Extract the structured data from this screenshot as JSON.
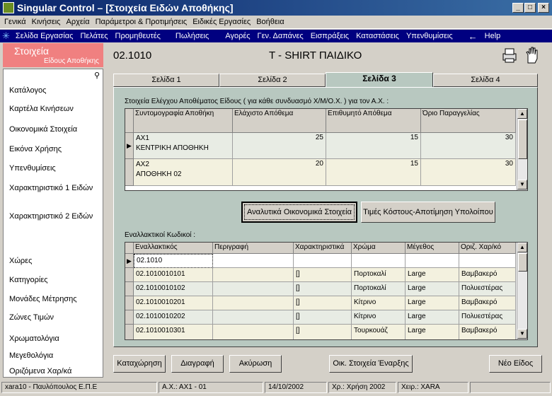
{
  "title": "Singular Control – [Στοιχεία Ειδών Αποθήκης]",
  "menu": [
    "Γενικά",
    "Κινήσεις",
    "Αρχεία",
    "Παράμετροι & Προτιμήσεις",
    "Ειδικές Εργασίες",
    "Βοήθεια"
  ],
  "nav": [
    "Σελίδα Εργασίας",
    "Πελάτες",
    "Προμηθευτές",
    "Πωλήσεις",
    "Αγορές",
    "Γεν. Δαπάνες",
    "Εισπράξεις",
    "Καταστάσεις",
    "Υπενθυμίσεις"
  ],
  "help": "Help",
  "header": {
    "left_title": "Στοιχεία",
    "left_sub": "Είδους Αποθήκης",
    "code": "02.1010",
    "name": "T - SHIRT ΠΑΙΔΙΚΟ"
  },
  "sidebar": [
    "Κατάλογος",
    "Καρτέλα Κινήσεων",
    "Οικονομικά Στοιχεία",
    "Εικόνα Χρήσης",
    "Υπενθυμίσεις",
    "Χαρακτηριστικό 1 Ειδών",
    "Χαρακτηριστικό 2 Ειδών",
    "Χώρες",
    "Κατηγορίες",
    "Μονάδες Μέτρησης",
    "Ζώνες Τιμών",
    "Χρωματολόγια",
    "Μεγεθολόγια",
    "Οριζόμενα Χαρ/κά"
  ],
  "tabs": [
    "Σελίδα 1",
    "Σελίδα 2",
    "Σελίδα 3",
    "Σελίδα 4"
  ],
  "stock": {
    "caption": "Στοιχεία Ελέγχου Αποθέματος Είδους ( για κάθε συνδυασμό Χ/Μ/Ο.Χ. ) για τον Α.Χ. :",
    "headers": [
      "Συντομογραφία Αποθήκη",
      "Ελάχιστο Απόθεμα",
      "Επιθυμητό Απόθεμα",
      "Όριο Παραγγελίας"
    ],
    "rows": [
      {
        "code": "ΑΧ1",
        "name": "ΚΕΝΤΡΙΚΗ ΑΠΟΘΗΚΗ",
        "min": "25",
        "want": "15",
        "order": "30"
      },
      {
        "code": "ΑΧ2",
        "name": "ΑΠΟΘΗΚΗ 02",
        "min": "20",
        "want": "15",
        "order": "30"
      }
    ]
  },
  "buttons_mid": [
    "Αναλυτικά Οικονομικά Στοιχεία",
    "Τιμές Κόστους-Αποτίμηση Υπολοίπου"
  ],
  "alt": {
    "caption": "Εναλλακτικοί Κωδικοί :",
    "headers": [
      "Εναλλακτικός",
      "Περιγραφή",
      "Χαρακτηριστικά",
      "Χρώμα",
      "Μέγεθος",
      "Οριζ. Χαρ/κό"
    ],
    "rows": [
      [
        "02.1010",
        "",
        "",
        "",
        "",
        ""
      ],
      [
        "02.1010010101",
        "",
        "[]",
        "Πορτοκαλί",
        "Large",
        "Βαμβακερό"
      ],
      [
        "02.1010010102",
        "",
        "[]",
        "Πορτοκαλί",
        "Large",
        "Πολυεστέρας"
      ],
      [
        "02.1010010201",
        "",
        "[]",
        "Κίτρινο",
        "Large",
        "Βαμβακερό"
      ],
      [
        "02.1010010202",
        "",
        "[]",
        "Κίτρινο",
        "Large",
        "Πολυεστέρας"
      ],
      [
        "02.1010010301",
        "",
        "[]",
        "Τουρκουάζ",
        "Large",
        "Βαμβακερό"
      ]
    ]
  },
  "buttons_bottom": [
    "Καταχώρηση",
    "Διαγραφή",
    "Ακύρωση",
    "Οικ. Στοιχεία Έναρξης",
    "Νέο Είδος"
  ],
  "status": [
    "xara10 - Παυλόπουλος Ε.Π.Ε",
    "Α.Χ.: ΑΧ1 - 01",
    "14/10/2002",
    "Χρ.: Χρήση 2002",
    "Χειρ.: XARA"
  ]
}
